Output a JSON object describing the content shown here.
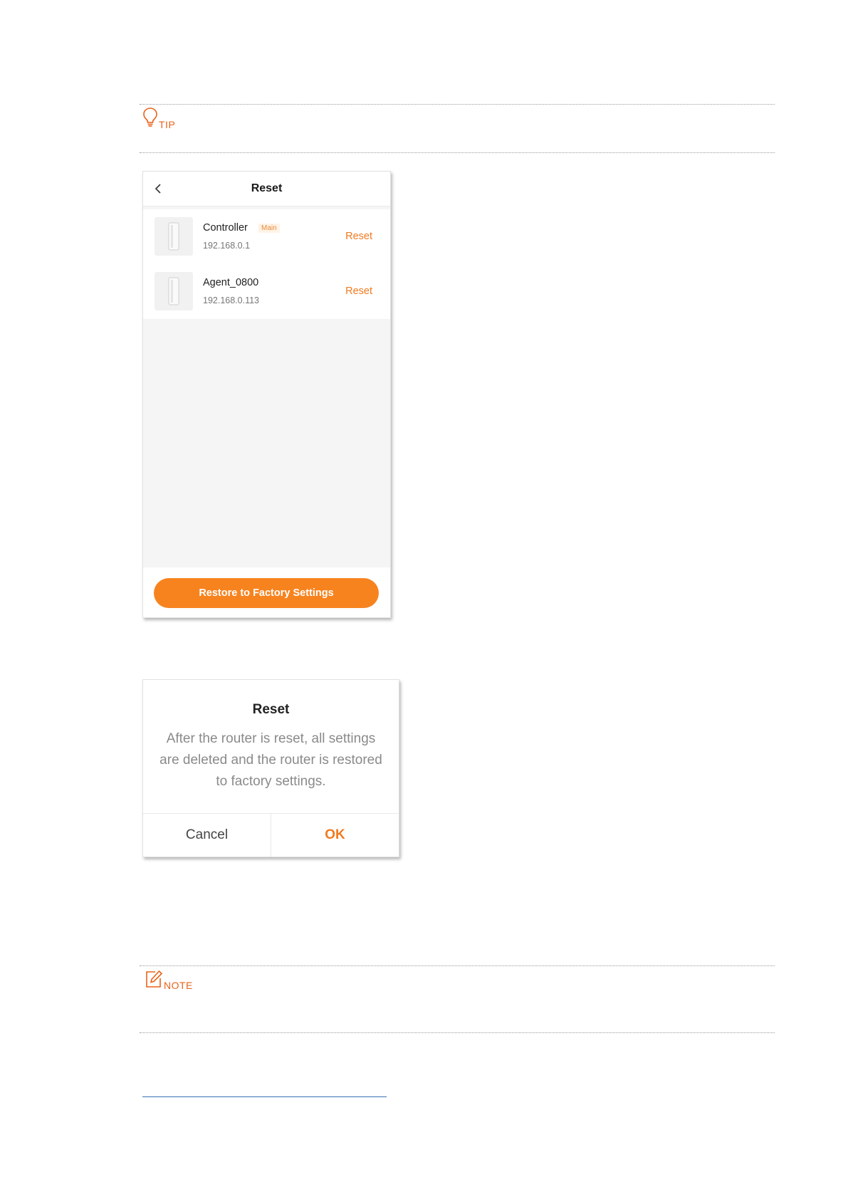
{
  "tip": {
    "label": "TIP"
  },
  "note": {
    "label": "NOTE"
  },
  "reset_screen": {
    "title": "Reset",
    "devices": [
      {
        "name": "Controller",
        "badge": "Main",
        "ip": "192.168.0.1",
        "action": "Reset"
      },
      {
        "name": "Agent_0800",
        "badge": "",
        "ip": "192.168.0.113",
        "action": "Reset"
      }
    ],
    "restore_button": "Restore to Factory Settings"
  },
  "reset_dialog": {
    "title": "Reset",
    "message": "After the router is reset, all settings are deleted and the router is restored to factory settings.",
    "cancel": "Cancel",
    "ok": "OK"
  },
  "colors": {
    "accent": "#f7831f",
    "callout": "#e8631a",
    "rule": "#3a6fb8"
  }
}
